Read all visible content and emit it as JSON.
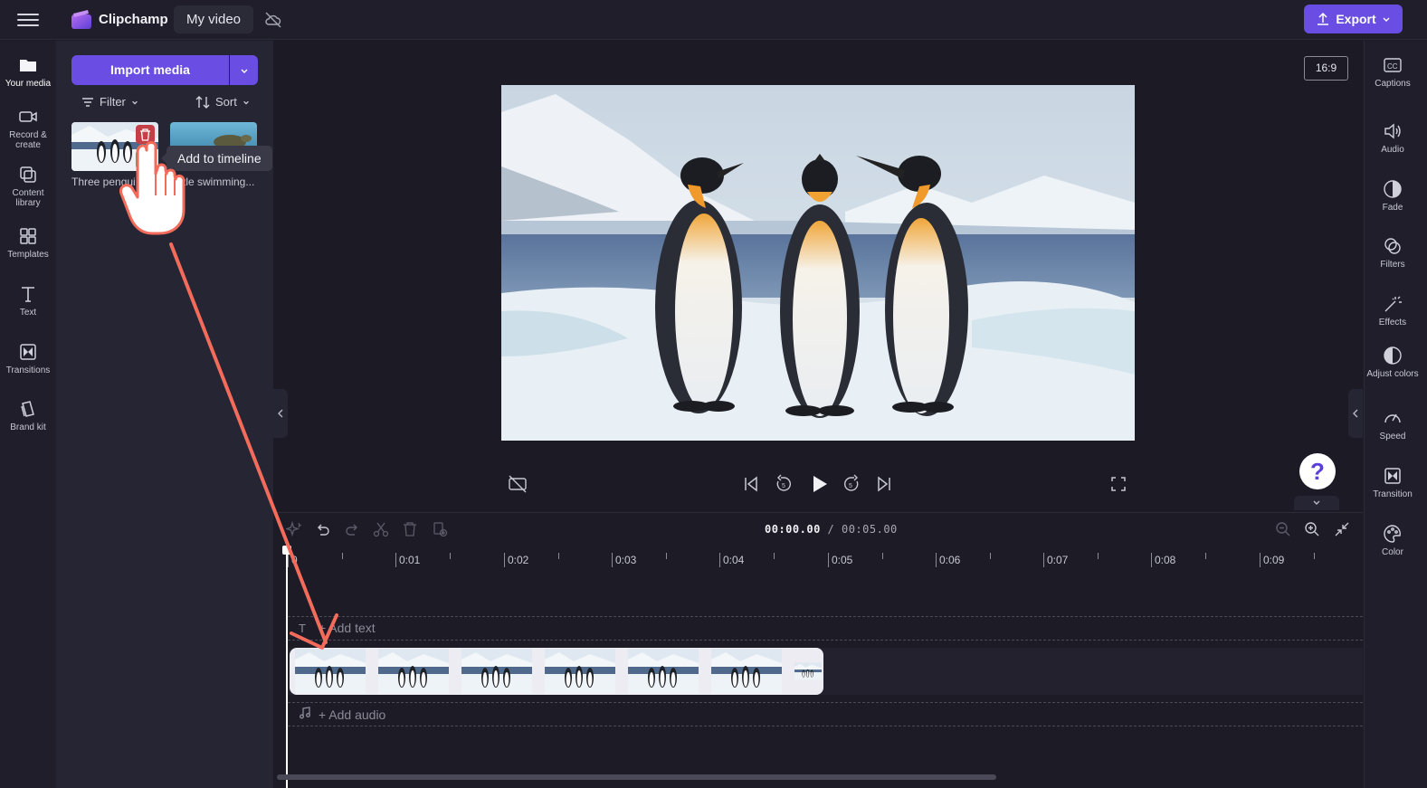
{
  "topbar": {
    "brand": "Clipchamp",
    "project_name": "My video",
    "export_label": "Export"
  },
  "left_nav": {
    "items": [
      {
        "label": "Your media",
        "icon": "folder-icon"
      },
      {
        "label": "Record & create",
        "icon": "camera-icon"
      },
      {
        "label": "Content library",
        "icon": "library-icon"
      },
      {
        "label": "Templates",
        "icon": "templates-icon"
      },
      {
        "label": "Text",
        "icon": "text-icon"
      },
      {
        "label": "Transitions",
        "icon": "transitions-icon"
      },
      {
        "label": "Brand kit",
        "icon": "brand-kit-icon"
      }
    ]
  },
  "media_panel": {
    "import_label": "Import media",
    "filter_label": "Filter",
    "sort_label": "Sort",
    "assets": [
      {
        "caption": "Three pengui..."
      },
      {
        "caption": "rtle swimming..."
      }
    ],
    "tooltip": "Add to timeline"
  },
  "preview": {
    "aspect_ratio": "16:9",
    "help_label": "?"
  },
  "right_nav": {
    "items": [
      {
        "label": "Captions",
        "icon": "captions-icon"
      },
      {
        "label": "Audio",
        "icon": "speaker-icon"
      },
      {
        "label": "Fade",
        "icon": "fade-icon"
      },
      {
        "label": "Filters",
        "icon": "filters-icon"
      },
      {
        "label": "Effects",
        "icon": "magic-wand-icon"
      },
      {
        "label": "Adjust colors",
        "icon": "contrast-icon"
      },
      {
        "label": "Speed",
        "icon": "speedometer-icon"
      },
      {
        "label": "Transition",
        "icon": "transition-icon"
      },
      {
        "label": "Color",
        "icon": "palette-icon"
      }
    ]
  },
  "timeline": {
    "current_time": "00:00.00",
    "duration": "/ 00:05.00",
    "ruler_labels": [
      "0",
      "0:01",
      "0:02",
      "0:03",
      "0:04",
      "0:05",
      "0:06",
      "0:07",
      "0:08",
      "0:09"
    ],
    "add_text_label": "+ Add text",
    "add_audio_label": "+ Add audio"
  },
  "colors": {
    "accent": "#6a4ee3",
    "delete": "#c24046",
    "add": "#2f9e6a",
    "annotation_arrow": "#f26b5b"
  }
}
